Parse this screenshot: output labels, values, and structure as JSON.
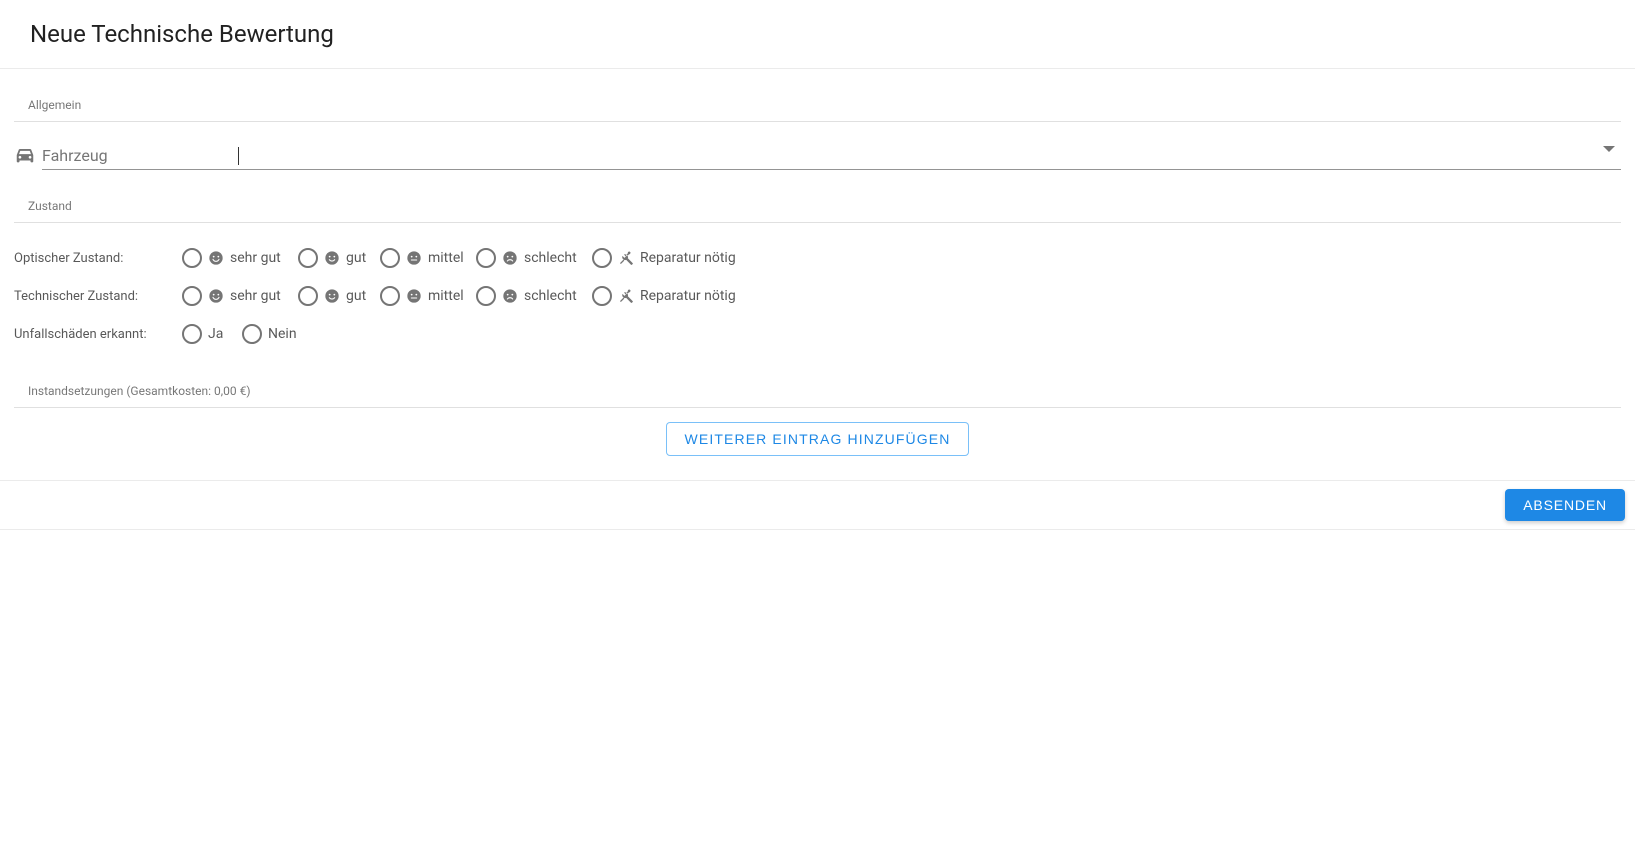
{
  "header": {
    "title": "Neue Technische Bewertung"
  },
  "sections": {
    "general": {
      "label": "Allgemein"
    },
    "condition": {
      "label": "Zustand"
    },
    "repairs": {
      "label_full": "Instandsetzungen (Gesamtkosten: 0,00 €)"
    }
  },
  "vehicleField": {
    "placeholder": "Fahrzeug",
    "value": ""
  },
  "conditionRows": {
    "optical": {
      "label": "Optischer Zustand:"
    },
    "technical": {
      "label": "Technischer Zustand:"
    },
    "accident": {
      "label": "Unfallschäden erkannt:"
    }
  },
  "conditionOptions": [
    {
      "icon": "face-happy",
      "label": "sehr gut"
    },
    {
      "icon": "face-smile",
      "label": "gut"
    },
    {
      "icon": "face-neutral",
      "label": "mittel"
    },
    {
      "icon": "face-sad",
      "label": "schlecht"
    },
    {
      "icon": "tools",
      "label": "Reparatur nötig"
    }
  ],
  "yesNoOptions": [
    {
      "label": "Ja"
    },
    {
      "label": "Nein"
    }
  ],
  "buttons": {
    "addEntry": "Weiterer Eintrag hinzufügen",
    "submit": "Absenden"
  }
}
